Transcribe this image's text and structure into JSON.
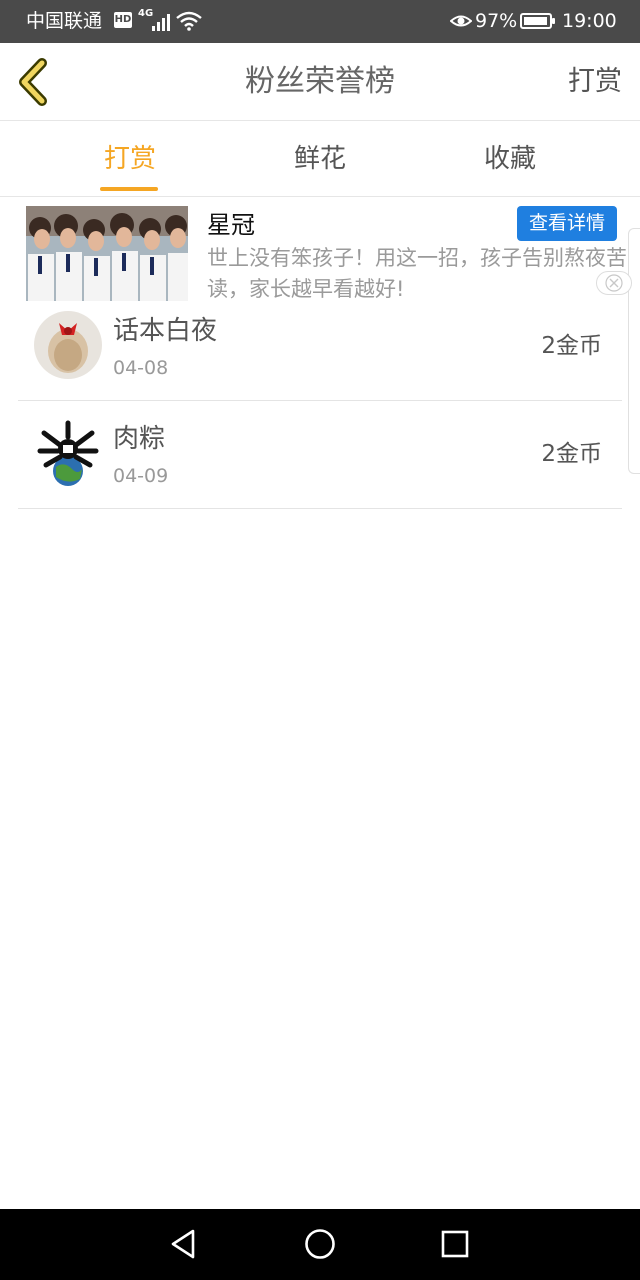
{
  "status_bar": {
    "carrier": "中国联通",
    "hd_badge": "HD",
    "network": "4G",
    "battery_percent": "97%",
    "battery_level": 0.97,
    "time": "19:00"
  },
  "header": {
    "title": "粉丝荣誉榜",
    "action_label": "打赏",
    "back_icon": "chevron-left-icon"
  },
  "tabs": [
    {
      "label": "打赏",
      "active": true
    },
    {
      "label": "鲜花",
      "active": false
    },
    {
      "label": "收藏",
      "active": false
    }
  ],
  "ad": {
    "title": "星冠",
    "description": "世上没有笨孩子！用这一招，孩子告别熬夜苦读，家长越早看越好!",
    "button_label": "查看详情"
  },
  "donors": [
    {
      "name": "话本白夜",
      "date": "04-08",
      "amount": "2金币"
    },
    {
      "name": "肉粽",
      "date": "04-09",
      "amount": "2金币"
    }
  ],
  "colors": {
    "accent": "#f5a623",
    "ad_button": "#1f7fe0",
    "status_bar": "#4a4a4a"
  }
}
